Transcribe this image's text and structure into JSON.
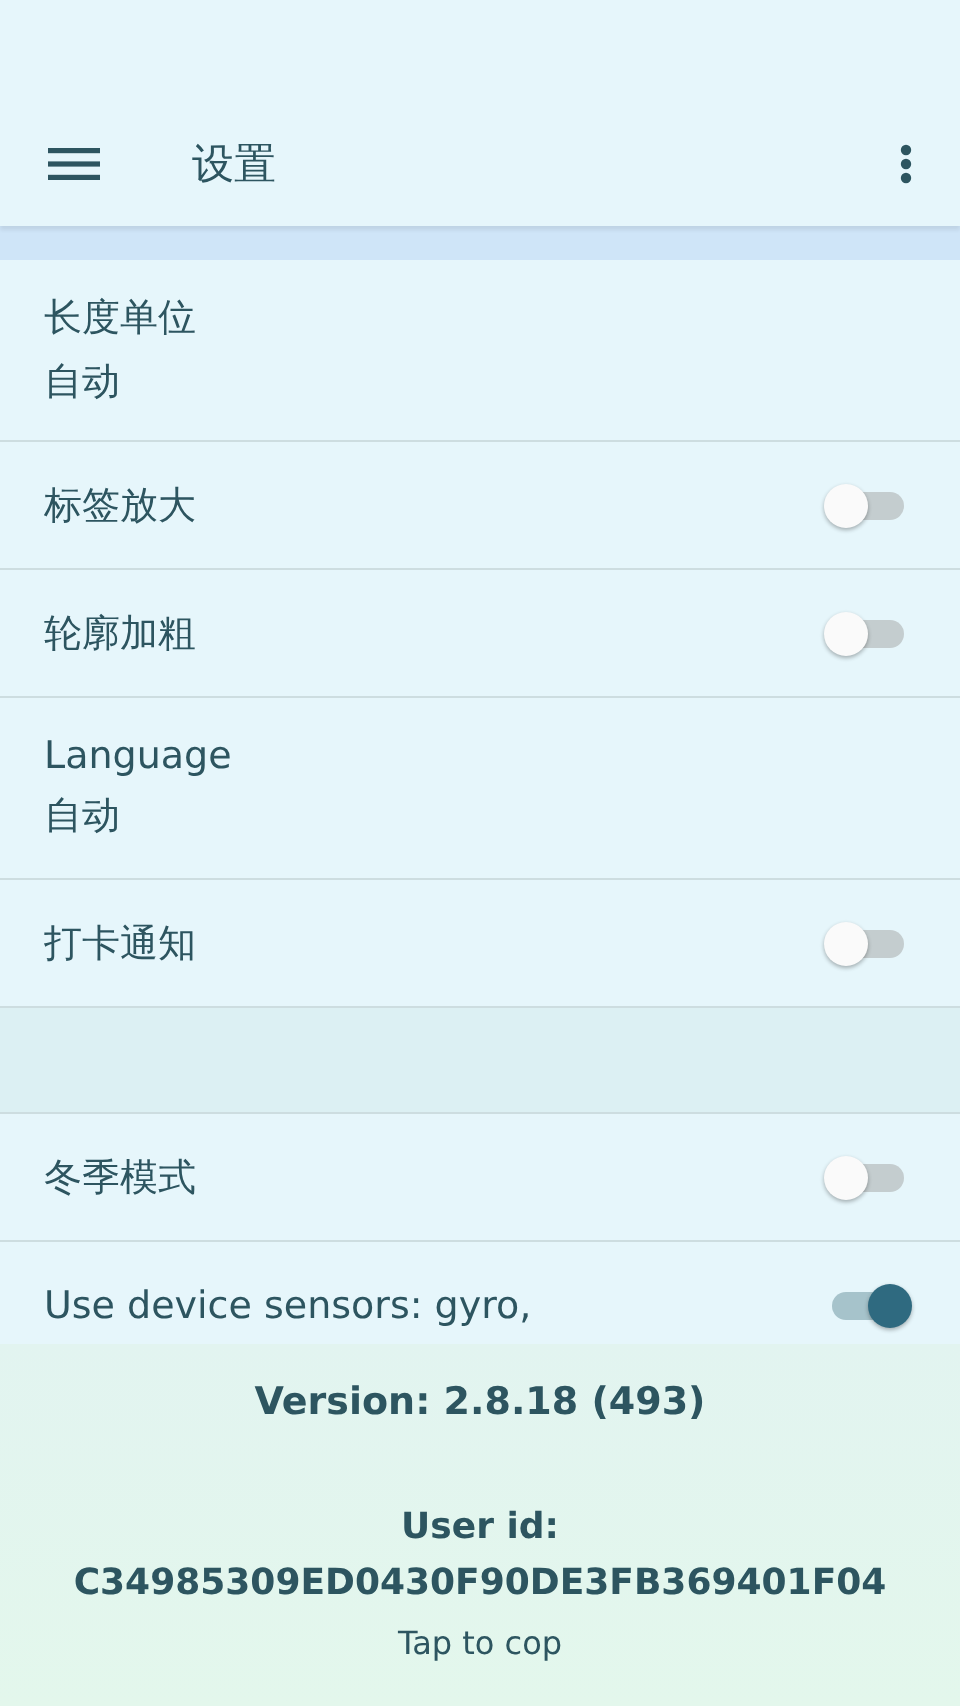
{
  "toolbar": {
    "title": "设置"
  },
  "settings": [
    {
      "kind": "value",
      "label": "长度单位",
      "value": "自动"
    },
    {
      "kind": "toggle",
      "label": "标签放大",
      "on": false
    },
    {
      "kind": "toggle",
      "label": "轮廓加粗",
      "on": false
    },
    {
      "kind": "value",
      "label": "Language",
      "value": "自动"
    },
    {
      "kind": "toggle",
      "label": "打卡通知",
      "on": false
    },
    {
      "kind": "gap"
    },
    {
      "kind": "toggle",
      "label": "冬季模式",
      "on": false
    },
    {
      "kind": "toggle",
      "label": "Use device sensors: gyro,",
      "on": true
    }
  ],
  "footer": {
    "version": "Version: 2.8.18 (493)",
    "user_id_label": "User id:",
    "user_id": "C34985309ED0430F90DE3FB369401F04",
    "hint": "Tap to cop"
  }
}
